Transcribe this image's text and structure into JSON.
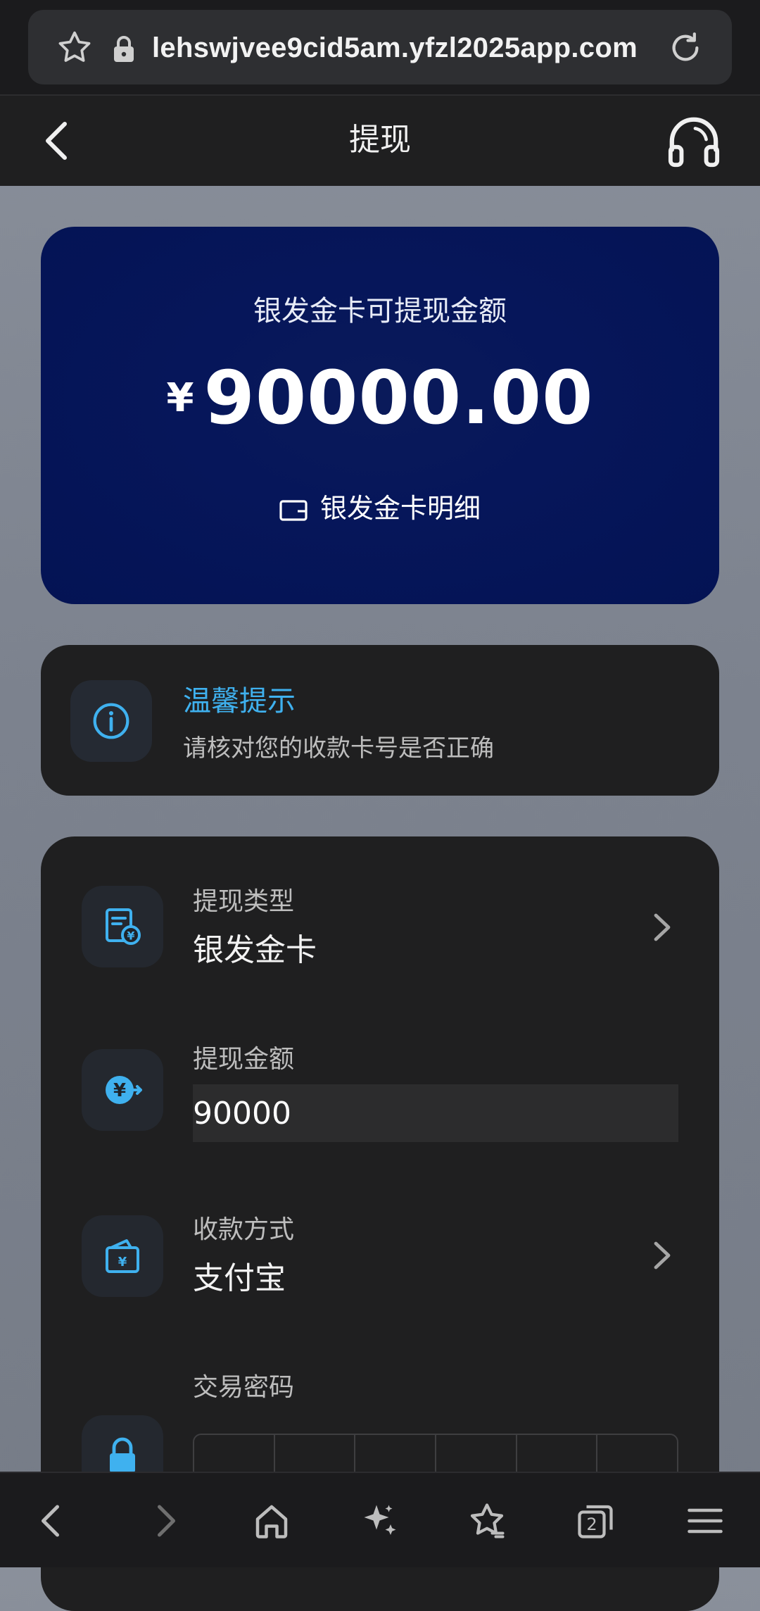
{
  "browser": {
    "url": "lehswjvee9cid5am.yfzl2025app.com",
    "tab_count": "2"
  },
  "header": {
    "title": "提现"
  },
  "balance": {
    "label": "银发金卡可提现金额",
    "currency": "¥",
    "amount": "90000.00",
    "detail_link": "银发金卡明细"
  },
  "tips": {
    "title": "温馨提示",
    "text": "请核对您的收款卡号是否正确"
  },
  "form": {
    "type_label": "提现类型",
    "type_value": "银发金卡",
    "amount_label": "提现金额",
    "amount_value": "90000",
    "method_label": "收款方式",
    "method_value": "支付宝",
    "password_label": "交易密码"
  },
  "colors": {
    "accent": "#3fb1ef",
    "card_blue": "#041354",
    "panel": "#1f1f20"
  }
}
